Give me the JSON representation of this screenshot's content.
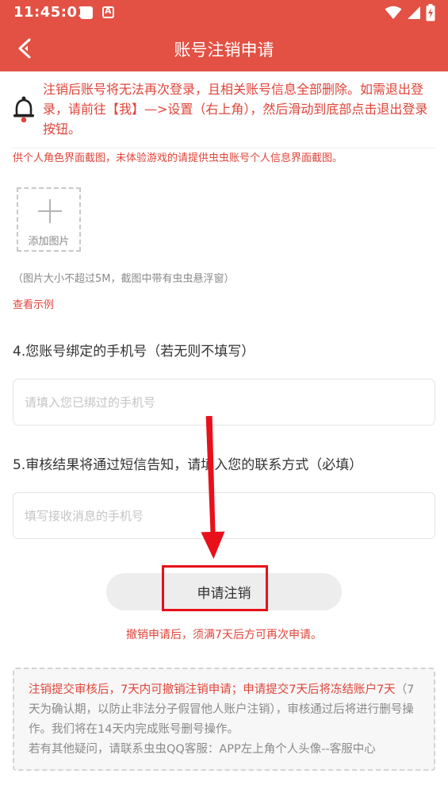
{
  "status_bar": {
    "time": "11:45:01",
    "icons": [
      "app-notification-icon",
      "app-a-icon",
      "wifi-icon",
      "signal-icon",
      "battery-charging-icon"
    ]
  },
  "header": {
    "title": "账号注销申请",
    "back_icon": "back-chevron-icon",
    "background_color": "#e25144"
  },
  "notice": {
    "icon": "bell-icon",
    "text": "注销后账号将无法再次登录，且相关账号信息全部删除。如需退出登录，请前往【我】—>设置（右上角），然后滑动到底部点击退出登录按钮。"
  },
  "upload": {
    "hint": "供个人角色界面截图，未体验游戏的请提供虫虫账号个人信息界面截图。",
    "add_label": "添加图片",
    "size_note": "（图片大小不超过5M，截图中带有虫虫悬浮窗）",
    "example_link": "查看示例"
  },
  "phone_section": {
    "label": "4.您账号绑定的手机号（若无则不填写）",
    "placeholder": "请填入您已绑过的手机号",
    "value": ""
  },
  "contact_section": {
    "label": "5.审核结果将通过短信告知，请填入您的联系方式（必填）",
    "placeholder": "填写接收消息的手机号",
    "value": ""
  },
  "submit": {
    "label": "申请注销",
    "note": "撤销申请后，须满7天后方可再次申请。"
  },
  "info": {
    "highlight_1": "注销提交审核后，7天内可撤销注销申请；申请提交7天后将冻结账户7天",
    "text_1": "（7天为确认期，以防止非法分子假冒他人账户注销），审核通过后将进行删号操作。我们将在14天内完成账号删号操作。",
    "text_2": "若有其他疑问，请联系虫虫QQ客服：APP左上角个人头像--客服中心"
  },
  "colors": {
    "accent": "#e25144",
    "warning_text": "#e0443a",
    "annotation": "#e8101a"
  }
}
